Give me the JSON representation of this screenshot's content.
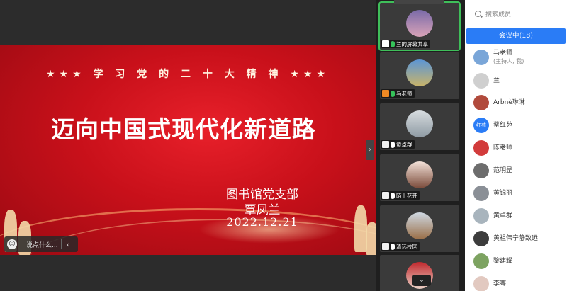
{
  "slide": {
    "subtitle": "★★★  学 习 党 的 二 十 大 精 神  ★★★",
    "title": "迈向中国式现代化新道路",
    "org": "图书馆党支部",
    "author": "覃凤兰",
    "date": "2022.12.21"
  },
  "chat": {
    "placeholder": "说点什么..."
  },
  "thumbnails": [
    {
      "label": "兰的屏幕共享",
      "icon": "screen-share-icon"
    },
    {
      "label": "马老师",
      "icon": "host-icon"
    },
    {
      "label": "黄卓群",
      "icon": "muted-camera-icon"
    },
    {
      "label": "陌上花开",
      "icon": "muted-camera-icon"
    },
    {
      "label": "清远校区",
      "icon": "muted-camera-icon"
    }
  ],
  "panel": {
    "search_placeholder": "搜索成员",
    "tab_label": "会议中(18)",
    "members": [
      {
        "name": "马老师",
        "sub": "(主持人, 我)",
        "avatar_color": "#7aa6d8",
        "avatar_text": ""
      },
      {
        "name": "兰",
        "sub": "",
        "avatar_color": "#cfcfcf",
        "avatar_text": ""
      },
      {
        "name": "Arḃnè琳琳",
        "sub": "",
        "avatar_color": "#b14a3c",
        "avatar_text": ""
      },
      {
        "name": "蔡红苑",
        "sub": "",
        "avatar_color": "#2a7cf6",
        "avatar_text": "红苑"
      },
      {
        "name": "陈老师",
        "sub": "",
        "avatar_color": "#d23b3b",
        "avatar_text": ""
      },
      {
        "name": "范明昰",
        "sub": "",
        "avatar_color": "#6d6d6d",
        "avatar_text": ""
      },
      {
        "name": "黄锦丽",
        "sub": "",
        "avatar_color": "#8a8f96",
        "avatar_text": ""
      },
      {
        "name": "黄卓群",
        "sub": "",
        "avatar_color": "#a8b4bd",
        "avatar_text": ""
      },
      {
        "name": "黄祖伟宁静致远",
        "sub": "",
        "avatar_color": "#3d3d3d",
        "avatar_text": ""
      },
      {
        "name": "黎建耀",
        "sub": "",
        "avatar_color": "#7da361",
        "avatar_text": ""
      },
      {
        "name": "李骞",
        "sub": "",
        "avatar_color": "#e2c9c0",
        "avatar_text": ""
      }
    ]
  },
  "colors": {
    "accent": "#2a7cf6",
    "slide_red": "#d5121c",
    "active_green": "#3fbf5a"
  }
}
